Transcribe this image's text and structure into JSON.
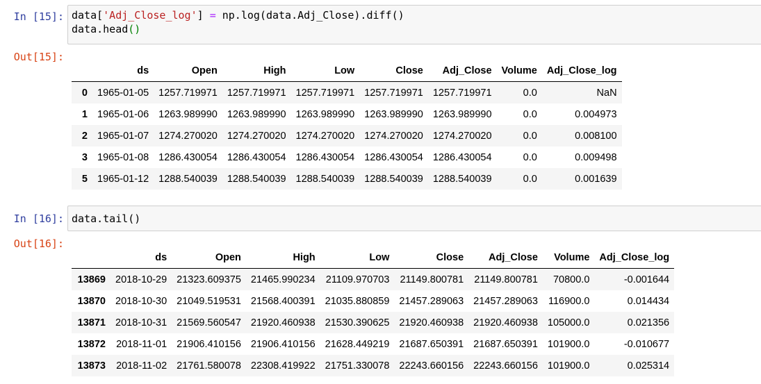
{
  "cells": [
    {
      "in_prompt": "In [15]:",
      "out_prompt": "Out[15]:",
      "code": {
        "line1": {
          "a": "data[",
          "b": "'Adj_Close_log'",
          "c": "] ",
          "d": "=",
          "e": " np.log(data.Adj_Close).diff()"
        },
        "line2": {
          "a": "data.head",
          "b": "()"
        }
      },
      "table": {
        "columns": [
          "ds",
          "Open",
          "High",
          "Low",
          "Close",
          "Adj_Close",
          "Volume",
          "Adj_Close_log"
        ],
        "rows": [
          {
            "index": "0",
            "cells": [
              "1965-01-05",
              "1257.719971",
              "1257.719971",
              "1257.719971",
              "1257.719971",
              "1257.719971",
              "0.0",
              "NaN"
            ]
          },
          {
            "index": "1",
            "cells": [
              "1965-01-06",
              "1263.989990",
              "1263.989990",
              "1263.989990",
              "1263.989990",
              "1263.989990",
              "0.0",
              "0.004973"
            ]
          },
          {
            "index": "2",
            "cells": [
              "1965-01-07",
              "1274.270020",
              "1274.270020",
              "1274.270020",
              "1274.270020",
              "1274.270020",
              "0.0",
              "0.008100"
            ]
          },
          {
            "index": "3",
            "cells": [
              "1965-01-08",
              "1286.430054",
              "1286.430054",
              "1286.430054",
              "1286.430054",
              "1286.430054",
              "0.0",
              "0.009498"
            ]
          },
          {
            "index": "5",
            "cells": [
              "1965-01-12",
              "1288.540039",
              "1288.540039",
              "1288.540039",
              "1288.540039",
              "1288.540039",
              "0.0",
              "0.001639"
            ]
          }
        ]
      }
    },
    {
      "in_prompt": "In [16]:",
      "out_prompt": "Out[16]:",
      "code": {
        "line1": {
          "a": "data.tail()"
        }
      },
      "table": {
        "columns": [
          "ds",
          "Open",
          "High",
          "Low",
          "Close",
          "Adj_Close",
          "Volume",
          "Adj_Close_log"
        ],
        "rows": [
          {
            "index": "13869",
            "cells": [
              "2018-10-29",
              "21323.609375",
              "21465.990234",
              "21109.970703",
              "21149.800781",
              "21149.800781",
              "70800.0",
              "-0.001644"
            ]
          },
          {
            "index": "13870",
            "cells": [
              "2018-10-30",
              "21049.519531",
              "21568.400391",
              "21035.880859",
              "21457.289063",
              "21457.289063",
              "116900.0",
              "0.014434"
            ]
          },
          {
            "index": "13871",
            "cells": [
              "2018-10-31",
              "21569.560547",
              "21920.460938",
              "21530.390625",
              "21920.460938",
              "21920.460938",
              "105000.0",
              "0.021356"
            ]
          },
          {
            "index": "13872",
            "cells": [
              "2018-11-01",
              "21906.410156",
              "21906.410156",
              "21628.449219",
              "21687.650391",
              "21687.650391",
              "101900.0",
              "-0.010677"
            ]
          },
          {
            "index": "13873",
            "cells": [
              "2018-11-02",
              "21761.580078",
              "22308.419922",
              "21751.330078",
              "22243.660156",
              "22243.660156",
              "101900.0",
              "0.025314"
            ]
          }
        ]
      }
    }
  ],
  "colors": {
    "in_prompt": "#303f9f",
    "out_prompt": "#d84315",
    "string_literal": "#ba2121",
    "operator": "#aa22ff",
    "matched_paren": "#008000",
    "input_background": "#f7f7f7",
    "striped_row": "#f5f5f5"
  }
}
